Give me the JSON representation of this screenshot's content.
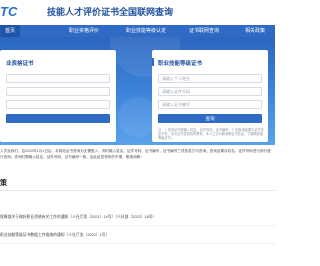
{
  "header": {
    "logo_text": "TC",
    "site_title": "技能人才评价证书全国联网查询"
  },
  "nav": {
    "items": [
      {
        "label": "首页",
        "active": true
      },
      {
        "label": "职业资格评价",
        "active": false
      },
      {
        "label": "职业技能等级认定",
        "active": false
      },
      {
        "label": "证书联网查询",
        "active": false
      },
      {
        "label": "相关政策",
        "active": false
      }
    ]
  },
  "left_card": {
    "title": "业资格证书",
    "name_placeholder": "",
    "id_placeholder": "",
    "cert_placeholder": "",
    "button_label": "",
    "note": ""
  },
  "right_card": {
    "title": "职业技能等级证书",
    "name_placeholder": "请输入个人姓名",
    "id_placeholder": "请输入证件号码",
    "cert_placeholder": "请输入证书编号",
    "button_label": "查询",
    "note": "注：1. 查询证书需输入姓名、证件号码、证书编号；2. 如查询结果与证书信息不符，请与证书发放机构联系，本人之行为取消和证书信息，了解新技能等级证书。"
  },
  "notice": {
    "line1": "人员及我们，自2020年1月1日后，本网站证书查询为无需登入，同时输入姓名、证件号码、证书编号，证书编号三项信息方可查询；查询结果对姓名、证件号码进行部分遮",
    "line2": "行查询；查询时需输入姓名、证件号码、证书编号一致，由此给您带来的不便，敬请谅解！"
  },
  "section": {
    "title": "策"
  },
  "documents": [
    {
      "text": "保障部关于做好职业资格有关工作的通知（人社厅发〔2021〕14号）（人社部〔2022〕18号）"
    },
    {
      "text": "职业技能等级证书数据工作指南的通知（人社厅发〔2022〕1号）"
    }
  ]
}
